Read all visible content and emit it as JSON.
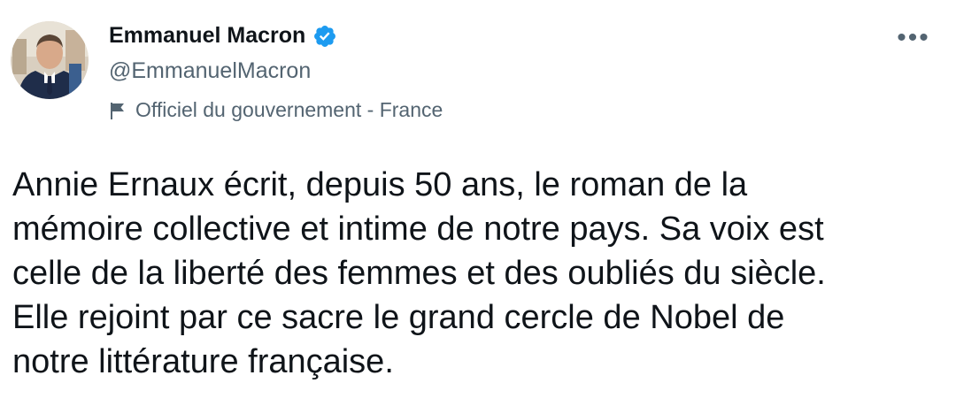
{
  "author": {
    "display_name": "Emmanuel Macron",
    "handle": "@EmmanuelMacron",
    "verified": true,
    "avatar_icon": "profile-photo",
    "label_icon": "flag-icon",
    "label": "Officiel du gouvernement - France"
  },
  "menu": {
    "more_label": "•••"
  },
  "tweet": {
    "text": "Annie Ernaux écrit, depuis 50 ans, le roman de la\nmémoire collective et intime de notre pays. Sa voix est\ncelle de la liberté des femmes et des oubliés du siècle.\nElle rejoint par ce sacre le grand cercle de Nobel de\nnotre littérature française."
  },
  "colors": {
    "text_primary": "#0f1419",
    "text_secondary": "#536471",
    "verified_blue": "#1d9bf0",
    "background": "#ffffff"
  }
}
